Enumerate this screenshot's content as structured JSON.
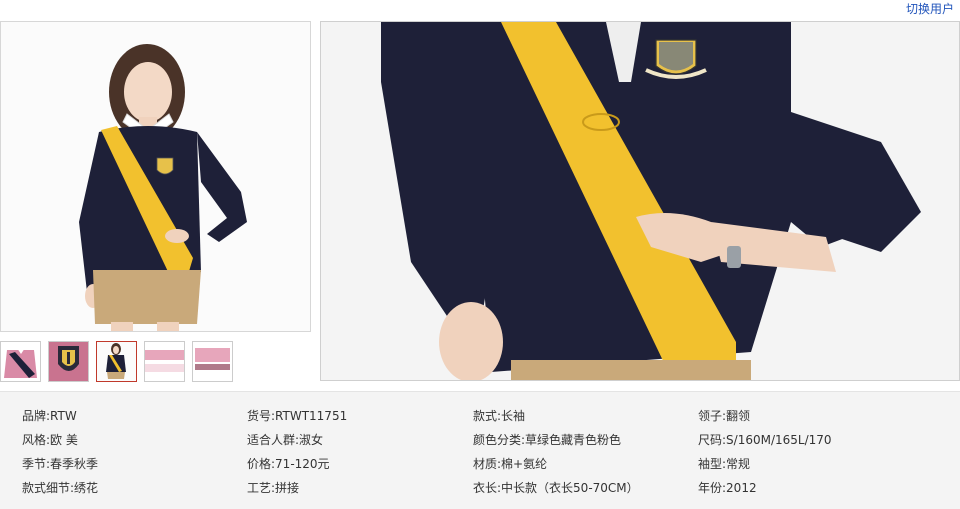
{
  "header": {
    "switch_user": "切换用户"
  },
  "thumbnails": [
    {
      "name": "pink-shirt-front",
      "active": false
    },
    {
      "name": "pink-shirt-crest",
      "active": false
    },
    {
      "name": "navy-shirt-model",
      "active": true
    },
    {
      "name": "pink-collar-detail",
      "active": false
    },
    {
      "name": "pink-fabric-detail",
      "active": false
    }
  ],
  "specs": [
    [
      "品牌:RTW",
      "货号:RTWT11751",
      "款式:长袖",
      "领子:翻领"
    ],
    [
      "风格:欧 美",
      "适合人群:淑女",
      "颜色分类:草绿色藏青色粉色",
      "尺码:S/160M/165L/170"
    ],
    [
      "季节:春季秋季",
      "价格:71-120元",
      "材质:棉+氨纶",
      "袖型:常规"
    ],
    [
      "款式细节:绣花",
      "工艺:拼接",
      "衣长:中长款（衣长50-70CM）",
      "年份:2012"
    ]
  ],
  "colors": {
    "shirt_navy": "#1e2038",
    "stripe_yellow": "#f2c12e",
    "skirt_khaki": "#c9a97a",
    "link_blue": "#2255bb",
    "active_border": "#c0392b",
    "pink": "#d98aa6"
  }
}
